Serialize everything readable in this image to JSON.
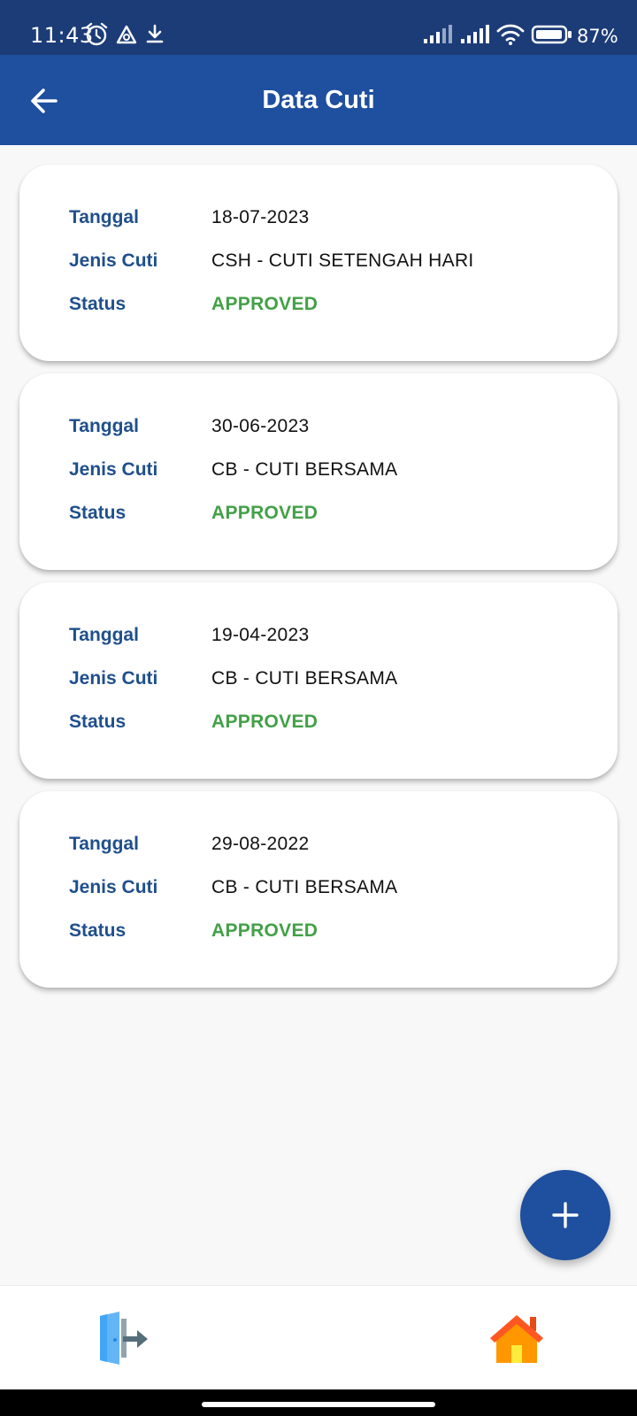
{
  "status_bar": {
    "time": "11:43",
    "battery_percent": "87%",
    "icons": [
      "alarm-icon",
      "hotspot-icon",
      "download-icon",
      "signal-icon",
      "signal-icon",
      "wifi-icon",
      "battery-icon"
    ]
  },
  "app_bar": {
    "title": "Data Cuti",
    "back_icon": "arrow-left-icon"
  },
  "labels": {
    "date": "Tanggal",
    "leave_type": "Jenis Cuti",
    "status": "Status"
  },
  "leave_records": [
    {
      "date": "18-07-2023",
      "leave_type": "CSH - CUTI SETENGAH HARI",
      "status": "APPROVED"
    },
    {
      "date": "30-06-2023",
      "leave_type": "CB - CUTI BERSAMA",
      "status": "APPROVED"
    },
    {
      "date": "19-04-2023",
      "leave_type": "CB - CUTI BERSAMA",
      "status": "APPROVED"
    },
    {
      "date": "29-08-2022",
      "leave_type": "CB - CUTI BERSAMA",
      "status": "APPROVED"
    }
  ],
  "fab": {
    "icon": "plus-icon"
  },
  "bottom_nav": {
    "left_icon": "logout-icon",
    "right_icon": "home-icon"
  },
  "colors": {
    "status_bar": "#1c3c78",
    "app_bar": "#1f4f9f",
    "label_text": "#1f4f8c",
    "approved": "#43a047",
    "background": "#f8f8f8",
    "home_icon": "#ff7a2f",
    "logout_icon": "#64b5f6"
  }
}
